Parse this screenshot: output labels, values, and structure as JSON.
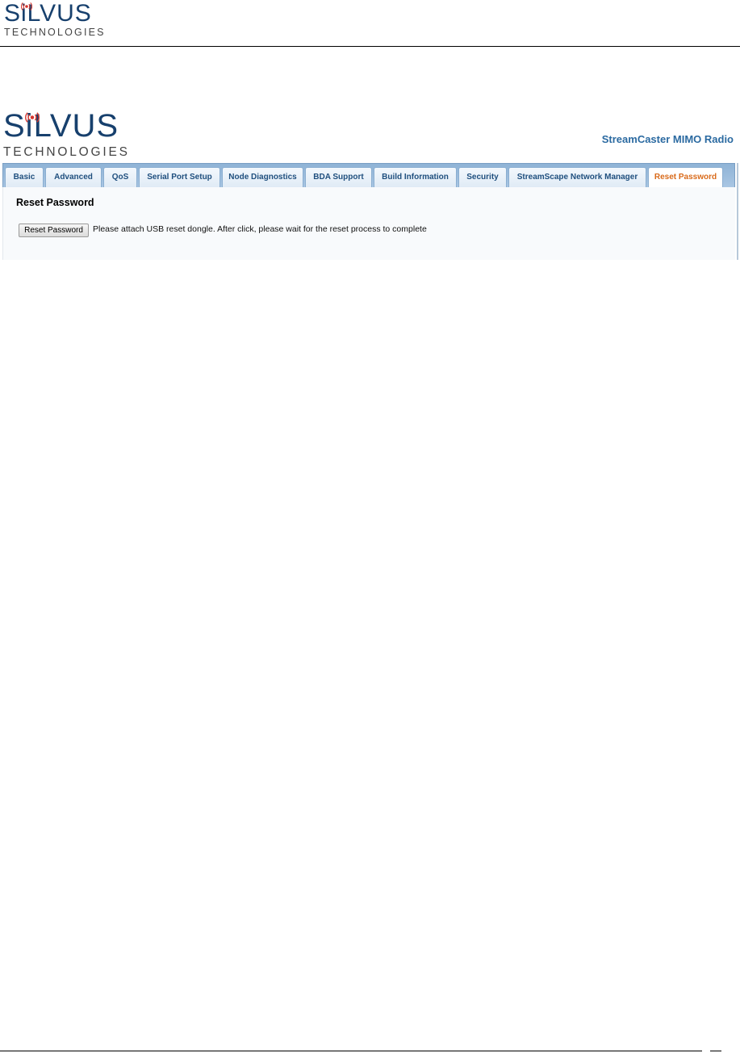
{
  "document": {
    "logo": {
      "wordmark": "SiLVUS",
      "tagline": "TECHNOLOGIES"
    }
  },
  "screenshot": {
    "logo": {
      "wordmark": "SiLVUS",
      "tagline": "TECHNOLOGIES"
    },
    "product_title": "StreamCaster MIMO Radio",
    "tabs": [
      {
        "label": "Basic",
        "active": false
      },
      {
        "label": "Advanced",
        "active": false
      },
      {
        "label": "QoS",
        "active": false
      },
      {
        "label": "Serial Port Setup",
        "active": false
      },
      {
        "label": "Node Diagnostics",
        "active": false
      },
      {
        "label": "BDA Support",
        "active": false
      },
      {
        "label": "Build Information",
        "active": false
      },
      {
        "label": "Security",
        "active": false
      },
      {
        "label": "StreamScape Network Manager",
        "active": false
      },
      {
        "label": "Reset Password",
        "active": true
      }
    ],
    "panel": {
      "heading": "Reset Password",
      "button_label": "Reset Password",
      "note": "Please attach USB reset dongle. After click, please wait for the reset process to complete"
    },
    "colors": {
      "brand_blue": "#17406d",
      "title_blue": "#2b6aa1",
      "active_tab": "#d96a1a",
      "signal_red": "#d6342c"
    }
  }
}
